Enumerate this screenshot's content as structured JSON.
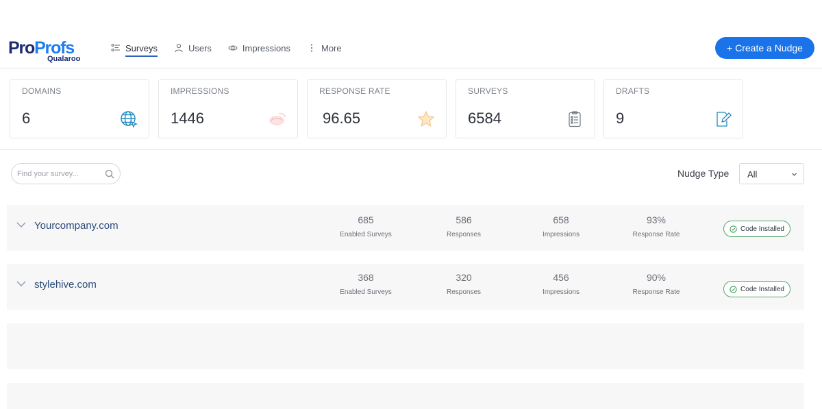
{
  "brand": {
    "logo_pro": "Pro",
    "logo_profs": "Profs",
    "logo_sub": "Qualaroo"
  },
  "nav": {
    "items": [
      {
        "label": "Surveys",
        "icon": "list-icon",
        "active": true
      },
      {
        "label": "Users",
        "icon": "user-icon",
        "active": false
      },
      {
        "label": "Impressions",
        "icon": "eye-icon",
        "active": false
      },
      {
        "label": "More",
        "icon": "kebab-icon",
        "active": false
      }
    ]
  },
  "header": {
    "create_label": "+ Create a Nudge"
  },
  "stats": [
    {
      "title": "DOMAINS",
      "value": "6",
      "icon": "globe-icon"
    },
    {
      "title": "IMPRESSIONS",
      "value": "1446",
      "icon": "impressions-icon"
    },
    {
      "title": "RESPONSE RATE",
      "value": "96.65",
      "icon": "star-icon"
    },
    {
      "title": "SURVEYS",
      "value": "6584",
      "icon": "clipboard-icon"
    },
    {
      "title": "DRAFTS",
      "value": "9",
      "icon": "edit-icon"
    }
  ],
  "search": {
    "placeholder": "Find your survey..."
  },
  "filter": {
    "label": "Nudge Type",
    "value": "All"
  },
  "domains": [
    {
      "name": "Yourcompany.com",
      "metrics": [
        {
          "value": "685",
          "label": "Enabled Surveys"
        },
        {
          "value": "586",
          "label": "Responses"
        },
        {
          "value": "658",
          "label": "Impressions"
        },
        {
          "value": "93%",
          "label": "Response Rate"
        }
      ],
      "badge": "Code Installed"
    },
    {
      "name": "stylehive.com",
      "metrics": [
        {
          "value": "368",
          "label": "Enabled Surveys"
        },
        {
          "value": "320",
          "label": "Responses"
        },
        {
          "value": "456",
          "label": "Impressions"
        },
        {
          "value": "90%",
          "label": "Response Rate"
        }
      ],
      "badge": "Code Installed"
    }
  ],
  "colors": {
    "primary": "#1a73e8",
    "brand_dark": "#1c2a74",
    "brand_light": "#1d7cf2",
    "success": "#54a56a"
  }
}
